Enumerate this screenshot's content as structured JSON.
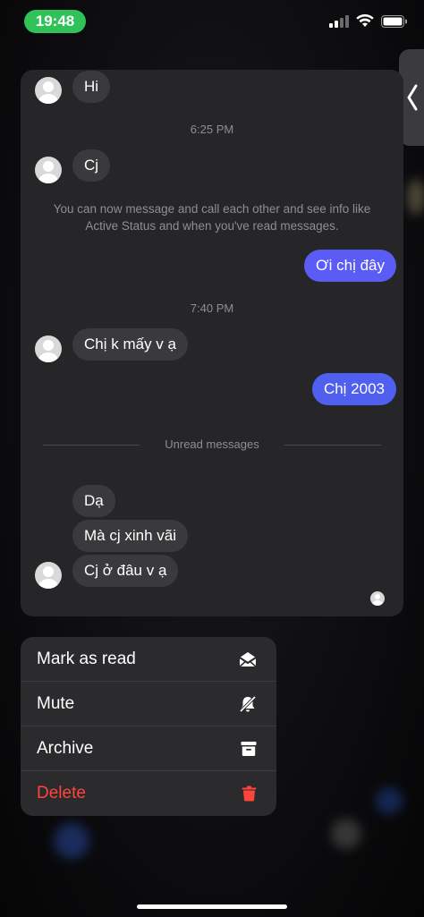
{
  "status_bar": {
    "time": "19:48"
  },
  "colors": {
    "outgoing_bubble": "#5b5bf5",
    "outgoing_bubble_alt": "#4f5ff0",
    "delete": "#ff453a",
    "time_pill": "#30c259"
  },
  "chat": {
    "msg_hi": "Hi",
    "ts_1": "6:25 PM",
    "msg_cj": "Cj",
    "notice": "You can now message and call each other and see info like Active Status and when you've read messages.",
    "out_1": "Ơi chị đây",
    "ts_2": "7:40 PM",
    "msg_3": "Chị k mấy v ạ",
    "out_2": "Chị 2003",
    "unread_label": "Unread messages",
    "msg_4": "Dạ",
    "msg_5": "Mà cj xinh vãi",
    "msg_6": "Cj ở đâu v ạ"
  },
  "menu": {
    "mark_as_read": "Mark as read",
    "mute": "Mute",
    "archive": "Archive",
    "delete": "Delete"
  }
}
